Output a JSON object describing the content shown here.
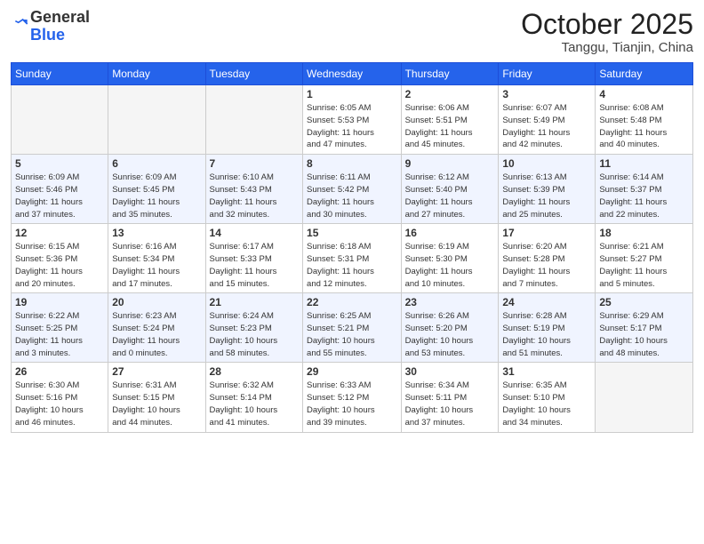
{
  "logo": {
    "general": "General",
    "blue": "Blue"
  },
  "header": {
    "month": "October 2025",
    "location": "Tanggu, Tianjin, China"
  },
  "weekdays": [
    "Sunday",
    "Monday",
    "Tuesday",
    "Wednesday",
    "Thursday",
    "Friday",
    "Saturday"
  ],
  "weeks": [
    [
      {
        "day": "",
        "info": ""
      },
      {
        "day": "",
        "info": ""
      },
      {
        "day": "",
        "info": ""
      },
      {
        "day": "1",
        "info": "Sunrise: 6:05 AM\nSunset: 5:53 PM\nDaylight: 11 hours\nand 47 minutes."
      },
      {
        "day": "2",
        "info": "Sunrise: 6:06 AM\nSunset: 5:51 PM\nDaylight: 11 hours\nand 45 minutes."
      },
      {
        "day": "3",
        "info": "Sunrise: 6:07 AM\nSunset: 5:49 PM\nDaylight: 11 hours\nand 42 minutes."
      },
      {
        "day": "4",
        "info": "Sunrise: 6:08 AM\nSunset: 5:48 PM\nDaylight: 11 hours\nand 40 minutes."
      }
    ],
    [
      {
        "day": "5",
        "info": "Sunrise: 6:09 AM\nSunset: 5:46 PM\nDaylight: 11 hours\nand 37 minutes."
      },
      {
        "day": "6",
        "info": "Sunrise: 6:09 AM\nSunset: 5:45 PM\nDaylight: 11 hours\nand 35 minutes."
      },
      {
        "day": "7",
        "info": "Sunrise: 6:10 AM\nSunset: 5:43 PM\nDaylight: 11 hours\nand 32 minutes."
      },
      {
        "day": "8",
        "info": "Sunrise: 6:11 AM\nSunset: 5:42 PM\nDaylight: 11 hours\nand 30 minutes."
      },
      {
        "day": "9",
        "info": "Sunrise: 6:12 AM\nSunset: 5:40 PM\nDaylight: 11 hours\nand 27 minutes."
      },
      {
        "day": "10",
        "info": "Sunrise: 6:13 AM\nSunset: 5:39 PM\nDaylight: 11 hours\nand 25 minutes."
      },
      {
        "day": "11",
        "info": "Sunrise: 6:14 AM\nSunset: 5:37 PM\nDaylight: 11 hours\nand 22 minutes."
      }
    ],
    [
      {
        "day": "12",
        "info": "Sunrise: 6:15 AM\nSunset: 5:36 PM\nDaylight: 11 hours\nand 20 minutes."
      },
      {
        "day": "13",
        "info": "Sunrise: 6:16 AM\nSunset: 5:34 PM\nDaylight: 11 hours\nand 17 minutes."
      },
      {
        "day": "14",
        "info": "Sunrise: 6:17 AM\nSunset: 5:33 PM\nDaylight: 11 hours\nand 15 minutes."
      },
      {
        "day": "15",
        "info": "Sunrise: 6:18 AM\nSunset: 5:31 PM\nDaylight: 11 hours\nand 12 minutes."
      },
      {
        "day": "16",
        "info": "Sunrise: 6:19 AM\nSunset: 5:30 PM\nDaylight: 11 hours\nand 10 minutes."
      },
      {
        "day": "17",
        "info": "Sunrise: 6:20 AM\nSunset: 5:28 PM\nDaylight: 11 hours\nand 7 minutes."
      },
      {
        "day": "18",
        "info": "Sunrise: 6:21 AM\nSunset: 5:27 PM\nDaylight: 11 hours\nand 5 minutes."
      }
    ],
    [
      {
        "day": "19",
        "info": "Sunrise: 6:22 AM\nSunset: 5:25 PM\nDaylight: 11 hours\nand 3 minutes."
      },
      {
        "day": "20",
        "info": "Sunrise: 6:23 AM\nSunset: 5:24 PM\nDaylight: 11 hours\nand 0 minutes."
      },
      {
        "day": "21",
        "info": "Sunrise: 6:24 AM\nSunset: 5:23 PM\nDaylight: 10 hours\nand 58 minutes."
      },
      {
        "day": "22",
        "info": "Sunrise: 6:25 AM\nSunset: 5:21 PM\nDaylight: 10 hours\nand 55 minutes."
      },
      {
        "day": "23",
        "info": "Sunrise: 6:26 AM\nSunset: 5:20 PM\nDaylight: 10 hours\nand 53 minutes."
      },
      {
        "day": "24",
        "info": "Sunrise: 6:28 AM\nSunset: 5:19 PM\nDaylight: 10 hours\nand 51 minutes."
      },
      {
        "day": "25",
        "info": "Sunrise: 6:29 AM\nSunset: 5:17 PM\nDaylight: 10 hours\nand 48 minutes."
      }
    ],
    [
      {
        "day": "26",
        "info": "Sunrise: 6:30 AM\nSunset: 5:16 PM\nDaylight: 10 hours\nand 46 minutes."
      },
      {
        "day": "27",
        "info": "Sunrise: 6:31 AM\nSunset: 5:15 PM\nDaylight: 10 hours\nand 44 minutes."
      },
      {
        "day": "28",
        "info": "Sunrise: 6:32 AM\nSunset: 5:14 PM\nDaylight: 10 hours\nand 41 minutes."
      },
      {
        "day": "29",
        "info": "Sunrise: 6:33 AM\nSunset: 5:12 PM\nDaylight: 10 hours\nand 39 minutes."
      },
      {
        "day": "30",
        "info": "Sunrise: 6:34 AM\nSunset: 5:11 PM\nDaylight: 10 hours\nand 37 minutes."
      },
      {
        "day": "31",
        "info": "Sunrise: 6:35 AM\nSunset: 5:10 PM\nDaylight: 10 hours\nand 34 minutes."
      },
      {
        "day": "",
        "info": ""
      }
    ]
  ]
}
